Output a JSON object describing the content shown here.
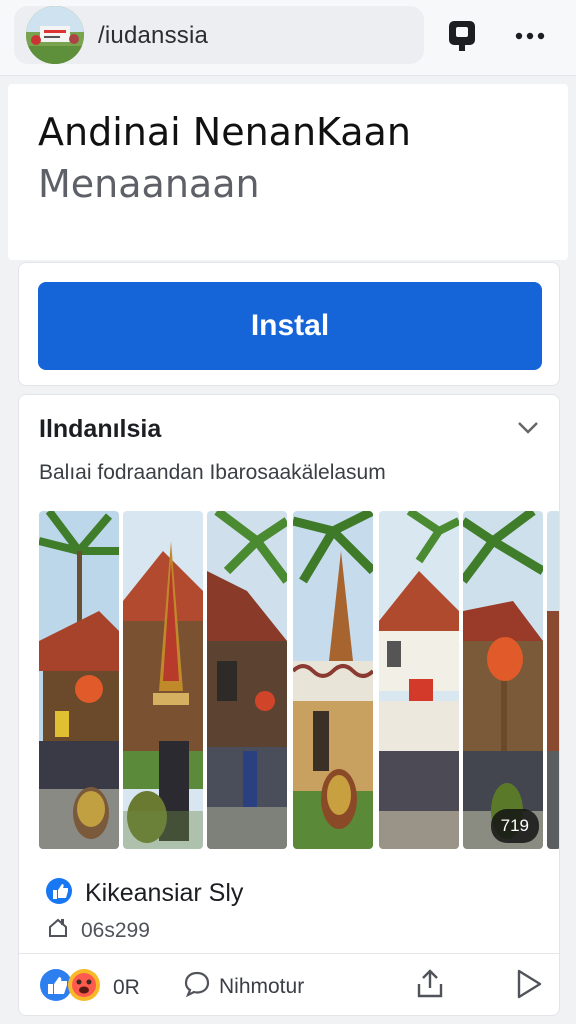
{
  "topbar": {
    "url_text": "/iudanssia",
    "avatar_icon": "profile-avatar",
    "phone_icon": "phone-icon",
    "more_icon": "more-dots-icon"
  },
  "header": {
    "title": "Andinai NenanKaan",
    "subtitle": "Menaanaan"
  },
  "install": {
    "button_label": "Instal",
    "color": "#1565d8"
  },
  "post": {
    "name": "Ilndanılsia",
    "caption": "Balıai fodraandan Ibarosaakälelasum",
    "photo_count_badge": "719",
    "page_name": "Kikeansiar Sly",
    "meta_text": "06s299",
    "reaction_count": "0R",
    "comment_label": "Nihmotur"
  }
}
